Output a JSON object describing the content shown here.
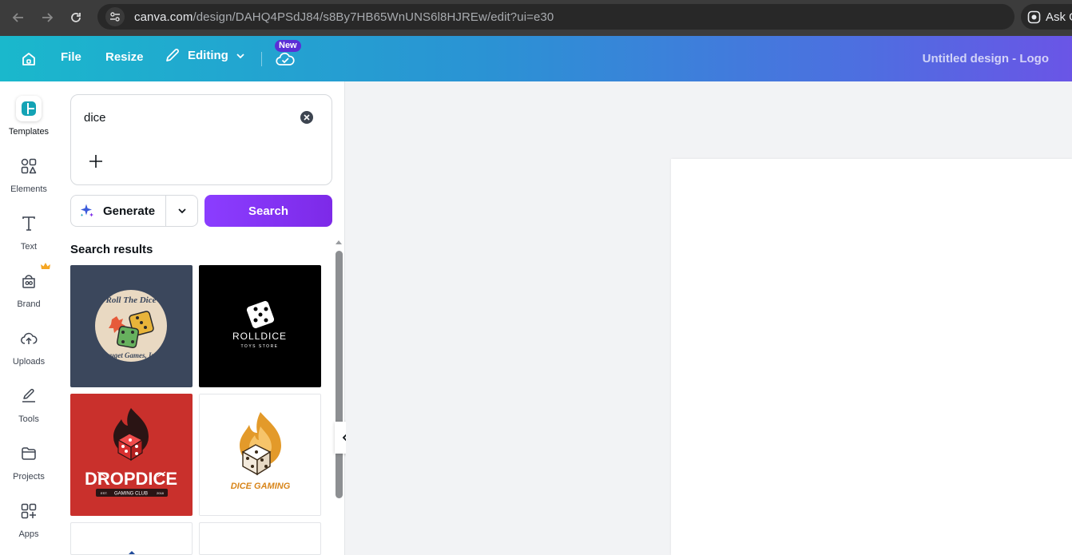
{
  "browser": {
    "url_host": "canva.com",
    "url_path": "/design/DAHQ4PSdJ84/s8By7HB65WnUNS6l8HJREw/edit?ui=e30",
    "ask_label": "Ask G"
  },
  "header": {
    "file_label": "File",
    "resize_label": "Resize",
    "editing_label": "Editing",
    "new_badge": "New",
    "design_title": "Untitled design - Logo",
    "gradient_colors": [
      "#1ab8cc",
      "#2a93d4",
      "#4d6fe0",
      "#6a55e6"
    ]
  },
  "rail": {
    "items": [
      {
        "label": "Templates",
        "icon": "templates-icon",
        "active": true
      },
      {
        "label": "Elements",
        "icon": "elements-icon"
      },
      {
        "label": "Text",
        "icon": "text-icon"
      },
      {
        "label": "Brand",
        "icon": "brand-icon"
      },
      {
        "label": "Uploads",
        "icon": "uploads-icon"
      },
      {
        "label": "Tools",
        "icon": "tools-icon"
      },
      {
        "label": "Projects",
        "icon": "projects-icon"
      },
      {
        "label": "Apps",
        "icon": "apps-icon"
      }
    ]
  },
  "panel": {
    "search_value": "dice",
    "generate_label": "Generate",
    "search_label": "Search",
    "results_title": "Search results",
    "accent_color": "#8b3dff",
    "results": [
      {
        "name": "Roll The Dice - Fauget Games, Inc.",
        "line1": "Roll The Dice",
        "line2": "Fauget Games, Inc."
      },
      {
        "name": "RollDice Toys Store",
        "line1": "ROLLDICE",
        "line2": "TOYS STORE"
      },
      {
        "name": "DropDice Gaming Club",
        "line1": "DROPDICE",
        "line2": "GAMING CLUB",
        "left_tag": "EST.",
        "right_tag": "2018"
      },
      {
        "name": "Dice Gaming",
        "line1": "DICE GAMING"
      }
    ]
  }
}
